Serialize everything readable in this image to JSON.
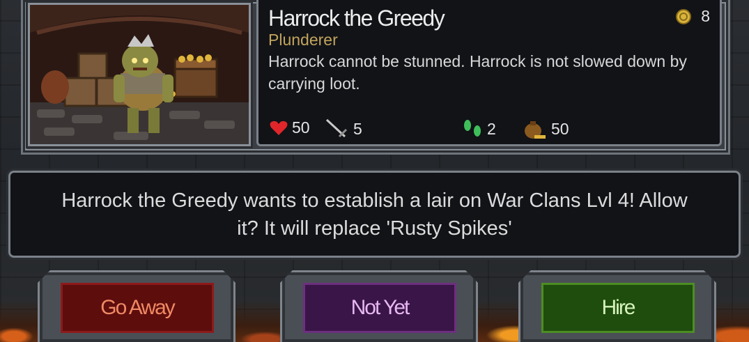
{
  "character": {
    "name": "Harrock the Greedy",
    "class": "Plunderer",
    "description": "Harrock cannot be stunned. Harrock is not slowed down by carrying loot.",
    "cost": "8",
    "stats": {
      "health": "50",
      "attack": "5",
      "speed": "2",
      "loot": "50"
    }
  },
  "message": "Harrock the Greedy wants to establish a lair on War Clans Lvl 4! Allow it? It will replace 'Rusty Spikes'",
  "buttons": {
    "go_away": "Go Away",
    "not_yet": "Not Yet",
    "hire": "Hire"
  },
  "colors": {
    "class_text": "#c2a45c",
    "go_away": "#5e0d0d",
    "not_yet": "#3a1547",
    "hire": "#1e4d0e"
  },
  "icons": {
    "cost": "gold-coin-icon",
    "health": "heart-icon",
    "attack": "sword-icon",
    "speed": "footsteps-icon",
    "loot": "loot-bag-icon"
  }
}
